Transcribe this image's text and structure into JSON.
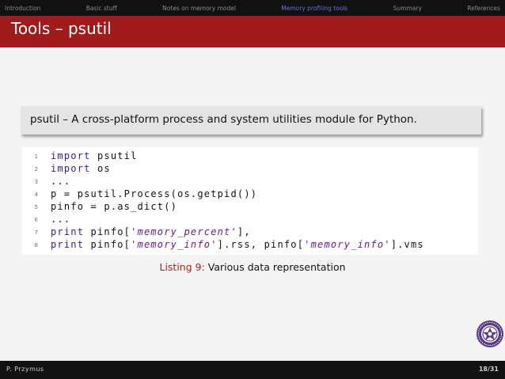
{
  "nav": {
    "items": [
      {
        "label": "Introduction",
        "active": false
      },
      {
        "label": "Basic stuff",
        "active": false
      },
      {
        "label": "Notes on memory model",
        "active": false
      },
      {
        "label": "Memory profiling tools",
        "active": true
      },
      {
        "label": "Summary",
        "active": false
      },
      {
        "label": "References",
        "active": false
      }
    ]
  },
  "slide": {
    "title": "Tools – psutil",
    "block_text": "psutil – A cross-platform process and system utilities module for Python."
  },
  "code": {
    "line_numbers": [
      "1",
      "2",
      "3",
      "4",
      "5",
      "6",
      "7",
      "8"
    ],
    "lines": [
      [
        {
          "t": "import",
          "k": "kw"
        },
        {
          "t": " psutil",
          "k": ""
        }
      ],
      [
        {
          "t": "import",
          "k": "kw"
        },
        {
          "t": " os",
          "k": ""
        }
      ],
      [
        {
          "t": "...",
          "k": ""
        }
      ],
      [
        {
          "t": "p = psutil.Process(os.getpid())",
          "k": ""
        }
      ],
      [
        {
          "t": "pinfo = p.as_dict()",
          "k": ""
        }
      ],
      [
        {
          "t": "...",
          "k": ""
        }
      ],
      [
        {
          "t": "print",
          "k": "kw"
        },
        {
          "t": " pinfo[",
          "k": ""
        },
        {
          "t": "'memory_percent'",
          "k": "str"
        },
        {
          "t": "],",
          "k": ""
        }
      ],
      [
        {
          "t": "print",
          "k": "kw"
        },
        {
          "t": " pinfo[",
          "k": ""
        },
        {
          "t": "'memory_info'",
          "k": "str"
        },
        {
          "t": "].rss, pinfo[",
          "k": ""
        },
        {
          "t": "'memory_info'",
          "k": "str"
        },
        {
          "t": "].vms",
          "k": ""
        }
      ]
    ]
  },
  "caption": {
    "label": "Listing 9:",
    "text": "Various data representation"
  },
  "footer": {
    "author": "P. Przymus",
    "page": "18/31"
  },
  "colors": {
    "title_bar": "#a01c1c",
    "nav_active": "#6b6fd6",
    "keyword": "#3a1a9a",
    "string": "#6a1a8a",
    "caption_label": "#b02020"
  },
  "icons": {
    "logo": "university-seal-icon"
  }
}
